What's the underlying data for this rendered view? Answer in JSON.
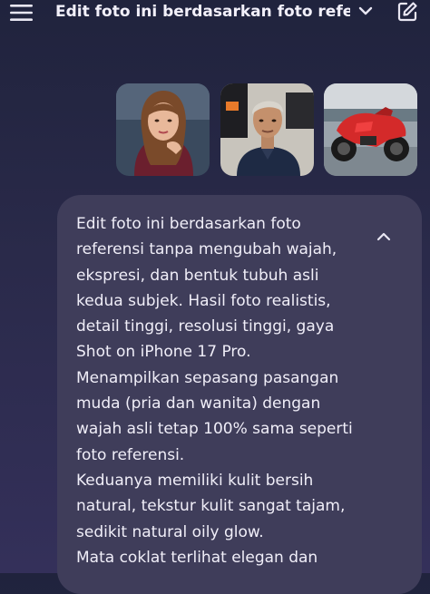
{
  "header": {
    "title": "Edit foto ini berdasarkan foto refer...",
    "icons": {
      "menu": "hamburger-menu-icon",
      "dropdown": "chevron-down-icon",
      "new_chat": "edit-icon"
    }
  },
  "attachments": [
    {
      "description": "woman portrait photo"
    },
    {
      "description": "man selfie photo"
    },
    {
      "description": "red motorcycle photo"
    }
  ],
  "message": {
    "lines": [
      "Edit foto ini berdasarkan foto",
      "referensi tanpa mengubah wajah,",
      "ekspresi, dan bentuk tubuh asli",
      "kedua subjek. Hasil foto realistis,",
      "detail tinggi, resolusi tinggi, gaya",
      "Shot on iPhone 17 Pro.",
      "Menampilkan sepasang pasangan",
      "muda (pria dan wanita) dengan",
      "wajah asli tetap 100% sama seperti",
      "foto referensi.",
      "Keduanya memiliki kulit bersih",
      "natural, tekstur kulit sangat tajam,",
      "sedikit natural oily glow.",
      "Mata coklat terlihat elegan dan"
    ],
    "collapse_icon": "chevron-up-icon"
  },
  "colors": {
    "background_top": "#20233d",
    "bubble": "#3f3d5a",
    "text": "#f0eef8"
  }
}
